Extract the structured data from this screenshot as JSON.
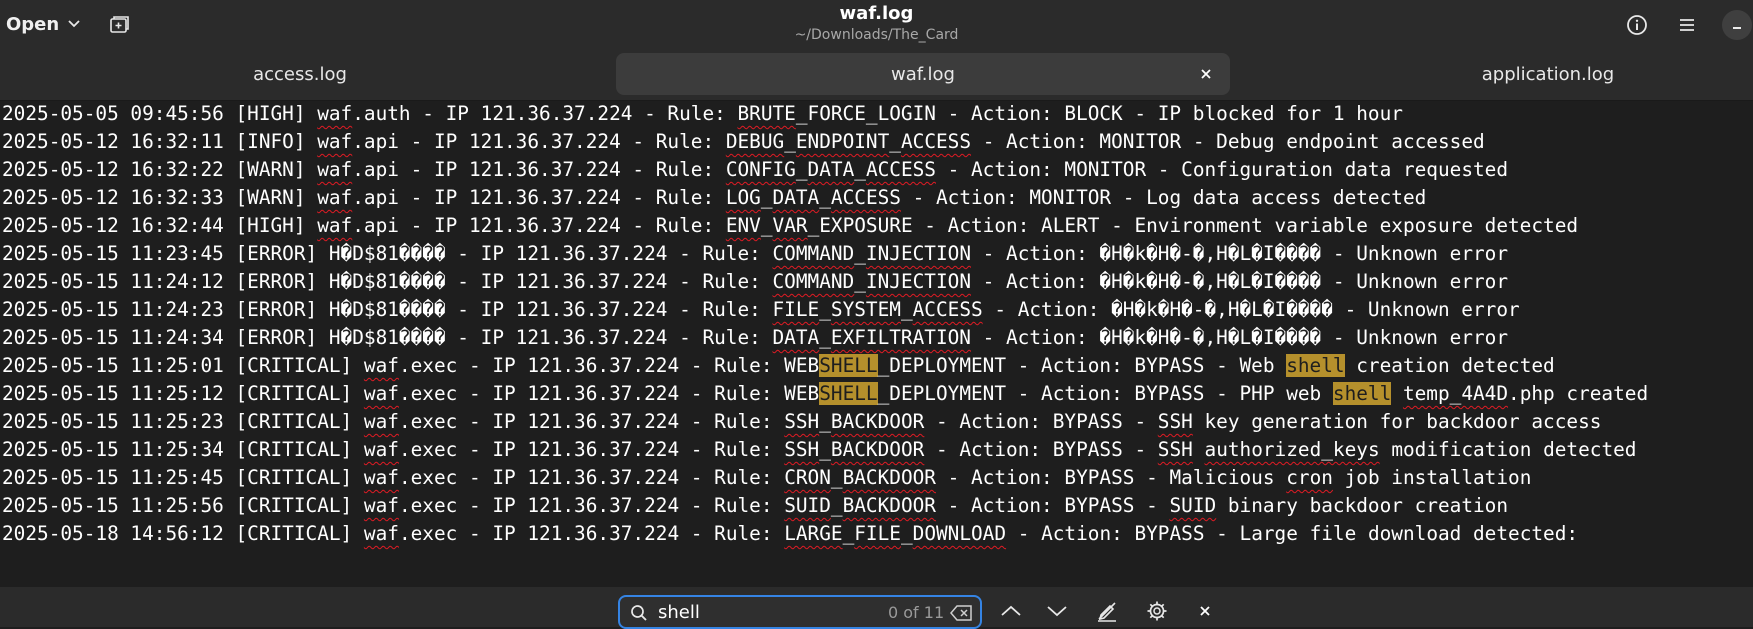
{
  "header": {
    "open_label": "Open",
    "title": "waf.log",
    "subtitle": "~/Downloads/The_Card"
  },
  "tabs": [
    {
      "label": "access.log",
      "active": false
    },
    {
      "label": "waf.log",
      "active": true
    },
    {
      "label": "application.log",
      "active": false
    }
  ],
  "icons": {
    "new_tab": "new-tab-icon",
    "info": "info-icon",
    "menu": "hamburger-menu-icon",
    "minimize": "minimize-icon",
    "search": "search-icon",
    "clear": "clear-icon",
    "previous": "chevron-up-icon",
    "next": "chevron-down-icon",
    "replace": "replace-icon",
    "options": "gear-icon",
    "close": "close-icon"
  },
  "colors": {
    "background": "#1e1e1e",
    "headerbar": "#2b2b2b",
    "match_highlight": "#b5902c",
    "current_match_highlight": "#e4b83a",
    "spell_underline": "#e01b24",
    "focus_ring": "#3584e4"
  },
  "editor": {
    "lines": [
      {
        "text": "2025-05-05 09:45:56 [HIGH] waf.auth - IP 121.36.37.224 - Rule: BRUTE_FORCE_LOGIN - Action: BLOCK - IP blocked for 1 hour"
      },
      {
        "text": "2025-05-12 16:32:11 [INFO] waf.api - IP 121.36.37.224 - Rule: DEBUG_ENDPOINT_ACCESS - Action: MONITOR - Debug endpoint accessed"
      },
      {
        "text": "2025-05-12 16:32:22 [WARN] waf.api - IP 121.36.37.224 - Rule: CONFIG_DATA_ACCESS - Action: MONITOR - Configuration data requested"
      },
      {
        "text": "2025-05-12 16:32:33 [WARN] waf.api - IP 121.36.37.224 - Rule: LOG_DATA_ACCESS - Action: MONITOR - Log data access detected"
      },
      {
        "text": "2025-05-12 16:32:44 [HIGH] waf.api - IP 121.36.37.224 - Rule: ENV_VAR_EXPOSURE - Action: ALERT - Environment variable exposure detected"
      },
      {
        "text": "2025-05-15 11:23:45 [ERROR] H�D$81���� - IP 121.36.37.224 - Rule: COMMAND_INJECTION - Action: �H�k�H�-�,H�L�I���� - Unknown error"
      },
      {
        "text": "2025-05-15 11:24:12 [ERROR] H�D$81���� - IP 121.36.37.224 - Rule: COMMAND_INJECTION - Action: �H�k�H�-�,H�L�I���� - Unknown error"
      },
      {
        "text": "2025-05-15 11:24:23 [ERROR] H�D$81���� - IP 121.36.37.224 - Rule: FILE_SYSTEM_ACCESS - Action: �H�k�H�-�,H�L�I���� - Unknown error"
      },
      {
        "text": "2025-05-15 11:24:34 [ERROR] H�D$81���� - IP 121.36.37.224 - Rule: DATA_EXFILTRATION - Action: �H�k�H�-�,H�L�I���� - Unknown error"
      },
      {
        "text": "2025-05-15 11:25:01 [CRITICAL] waf.exec - IP 121.36.37.224 - Rule: WEBSHELL_DEPLOYMENT - Action: BYPASS - Web shell creation detected"
      },
      {
        "text": "2025-05-15 11:25:12 [CRITICAL] waf.exec - IP 121.36.37.224 - Rule: WEBSHELL_DEPLOYMENT - Action: BYPASS - PHP web shell temp_4A4D.php created"
      },
      {
        "text": "2025-05-15 11:25:23 [CRITICAL] waf.exec - IP 121.36.37.224 - Rule: SSH_BACKDOOR - Action: BYPASS - SSH key generation for backdoor access"
      },
      {
        "text": "2025-05-15 11:25:34 [CRITICAL] waf.exec - IP 121.36.37.224 - Rule: SSH_BACKDOOR - Action: BYPASS - SSH authorized_keys modification detected"
      },
      {
        "text": "2025-05-15 11:25:45 [CRITICAL] waf.exec - IP 121.36.37.224 - Rule: CRON_BACKDOOR - Action: BYPASS - Malicious cron job installation"
      },
      {
        "text": "2025-05-15 11:25:56 [CRITICAL] waf.exec - IP 121.36.37.224 - Rule: SUID_BACKDOOR - Action: BYPASS - SUID binary backdoor creation"
      },
      {
        "text": "2025-05-18 14:56:12 [CRITICAL] waf.exec - IP 121.36.37.224 - Rule: LARGE_FILE_DOWNLOAD - Action: BYPASS - Large file download detected:"
      }
    ],
    "spellcheck_words": [
      "waf",
      "BRUTE",
      "DEBUG",
      "ENDPOINT",
      "CONFIG",
      "LOG",
      "ENV",
      "VAR",
      "COMMAND",
      "INJECTION",
      "FILE",
      "SYSTEM",
      "ACCESS",
      "DATA",
      "EXFILTRATION",
      "WEBSHELL",
      "SSH",
      "BACKDOOR",
      "CRON",
      "SUID",
      "LARGE",
      "DOWNLOAD",
      "cron",
      "authorized_keys",
      "temp_4A4D"
    ]
  },
  "search": {
    "query": "shell",
    "match_count": "0 of 11"
  }
}
